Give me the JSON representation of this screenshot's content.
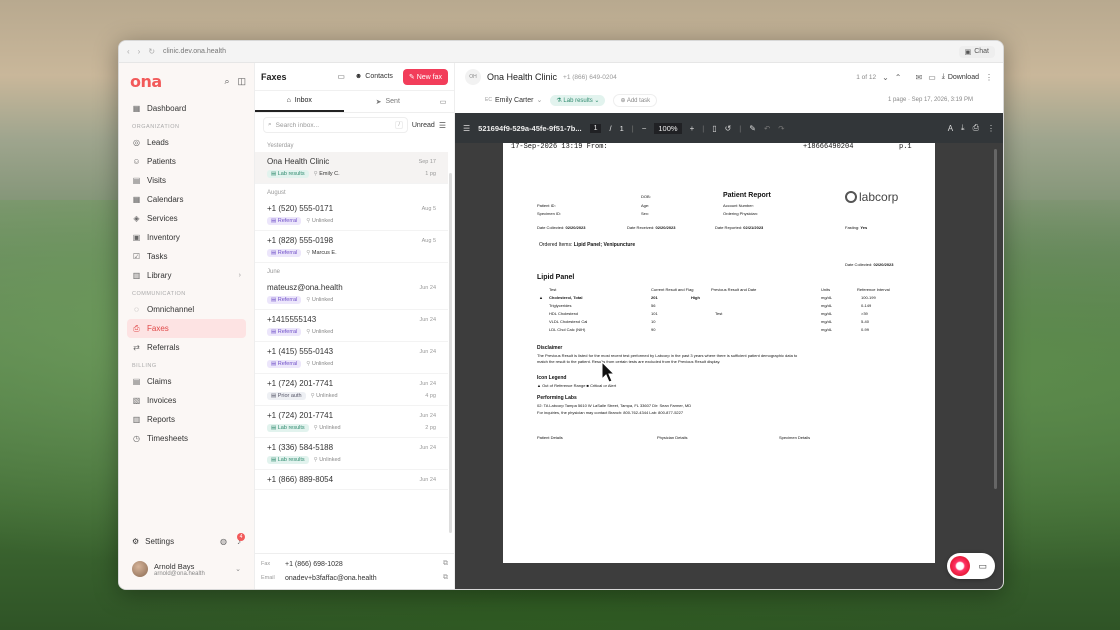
{
  "browser": {
    "url": "clinic.dev.ona.health",
    "chat_label": "Chat"
  },
  "sidebar": {
    "logo": "ona",
    "items_main": [
      {
        "label": "Dashboard",
        "icon": "dashboard-icon",
        "glyph": "▦"
      }
    ],
    "section_org": "ORGANIZATION",
    "items_org": [
      {
        "label": "Leads",
        "glyph": "◎"
      },
      {
        "label": "Patients",
        "glyph": "☺"
      },
      {
        "label": "Visits",
        "glyph": "▤"
      },
      {
        "label": "Calendars",
        "glyph": "▦"
      },
      {
        "label": "Services",
        "glyph": "◈"
      },
      {
        "label": "Inventory",
        "glyph": "▣"
      },
      {
        "label": "Tasks",
        "glyph": "☑"
      },
      {
        "label": "Library",
        "glyph": "▥"
      }
    ],
    "section_comm": "COMMUNICATION",
    "items_comm": [
      {
        "label": "Omnichannel",
        "glyph": "◌"
      },
      {
        "label": "Faxes",
        "glyph": "⎙"
      },
      {
        "label": "Referrals",
        "glyph": "⇄"
      }
    ],
    "section_billing": "BILLING",
    "items_billing": [
      {
        "label": "Claims",
        "glyph": "▤"
      },
      {
        "label": "Invoices",
        "glyph": "▧"
      },
      {
        "label": "Reports",
        "glyph": "▥"
      },
      {
        "label": "Timesheets",
        "glyph": "◷"
      }
    ],
    "settings": "Settings",
    "notif_count": "4",
    "user": {
      "name": "Arnold Bays",
      "email": "arnold@ona.health"
    }
  },
  "faxes": {
    "title": "Faxes",
    "contacts": "Contacts",
    "new_fax": "New fax",
    "tab_inbox": "Inbox",
    "tab_sent": "Sent",
    "search_placeholder": "Search inbox...",
    "search_kbd": "/",
    "unread": "Unread",
    "groups": [
      {
        "label": "Yesterday",
        "rows": [
          {
            "number": "Ona Health Clinic",
            "date": "Sep 17",
            "tag": "Lab results",
            "tagType": "lab",
            "assignee": "Emily C.",
            "named": true,
            "pages": "1 pg"
          }
        ]
      },
      {
        "label": "August",
        "rows": [
          {
            "number": "+1 (520) 555-0171",
            "date": "Aug 5",
            "tag": "Referral",
            "tagType": "ref",
            "assignee": "Unlinked",
            "named": false,
            "pages": ""
          },
          {
            "number": "+1 (828) 555-0198",
            "date": "Aug 5",
            "tag": "Referral",
            "tagType": "ref",
            "assignee": "Marcus E.",
            "named": true,
            "pages": ""
          }
        ]
      },
      {
        "label": "June",
        "rows": [
          {
            "number": "mateusz@ona.health",
            "date": "Jun 24",
            "tag": "Referral",
            "tagType": "ref",
            "assignee": "Unlinked",
            "named": false,
            "pages": ""
          },
          {
            "number": "+1415555143",
            "date": "Jun 24",
            "tag": "Referral",
            "tagType": "ref",
            "assignee": "Unlinked",
            "named": false,
            "pages": ""
          },
          {
            "number": "+1 (415) 555-0143",
            "date": "Jun 24",
            "tag": "Referral",
            "tagType": "ref",
            "assignee": "Unlinked",
            "named": false,
            "pages": ""
          },
          {
            "number": "+1 (724) 201-7741",
            "date": "Jun 24",
            "tag": "Prior auth",
            "tagType": "prior",
            "assignee": "Unlinked",
            "named": false,
            "pages": "4 pg"
          },
          {
            "number": "+1 (724) 201-7741",
            "date": "Jun 24",
            "tag": "Lab results",
            "tagType": "lab",
            "assignee": "Unlinked",
            "named": false,
            "pages": "2 pg"
          },
          {
            "number": "+1 (336) 584-5188",
            "date": "Jun 24",
            "tag": "Lab results",
            "tagType": "lab",
            "assignee": "Unlinked",
            "named": false,
            "pages": ""
          },
          {
            "number": "+1 (866) 889-8054",
            "date": "Jun 24",
            "tag": "",
            "tagType": "",
            "assignee": "",
            "named": false,
            "pages": ""
          }
        ]
      }
    ],
    "footer": {
      "fax_label": "Fax",
      "fax_value": "+1 (866) 698-1028",
      "email_label": "Email",
      "email_value": "onadev+b3faffac@ona.health"
    }
  },
  "detail": {
    "avatar": "OH",
    "name": "Ona Health Clinic",
    "phone": "+1 (866) 649-0204",
    "pager": "1 of 12",
    "download": "Download",
    "assignee": "Emily Carter",
    "tag": "Lab results",
    "add_task": "Add task",
    "meta": "1 page · Sep 17, 2026, 3:19 PM"
  },
  "viewer": {
    "filename": "521694f9-529a-45fe-9f51-7b...",
    "page": "1",
    "of": "/",
    "total": "1",
    "zoom": "100%"
  },
  "document": {
    "header_date": "17-Sep-2026  13:19    From:",
    "header_num": "+18666490204",
    "header_page": "p.1",
    "title": "Patient Report",
    "brand": "labcorp",
    "l_dob": "DOB:",
    "l_pid": "Patient ID:",
    "l_age": "Age:",
    "l_spec": "Specimen ID:",
    "l_sex": "Sex:",
    "l_acct": "Account Number:",
    "l_ordp": "Ordering Physician:",
    "date_collected_l": "Date Collected:",
    "date_collected": "02/20/2023",
    "date_received_l": "Date Received:",
    "date_received": "02/20/2023",
    "date_reported_l": "Date Reported:",
    "date_reported": "02/21/2023",
    "fasting_l": "Fasting:",
    "fasting": "Yes",
    "ordered_l": "Ordered Items:",
    "ordered": "Lipid Panel; Venipuncture",
    "panel": "Lipid Panel",
    "cols": [
      "Test",
      "Current Result and Flag",
      "Previous Result and Date",
      "Units",
      "Reference Interval"
    ],
    "rows": [
      {
        "test": "Cholesterol, Total",
        "res": "201",
        "flag": "High",
        "prev": "",
        "unit": "mg/dL",
        "ref": "100-199",
        "bold": true
      },
      {
        "test": "Triglycerides",
        "res": "56",
        "flag": "",
        "prev": "",
        "unit": "mg/dL",
        "ref": "0-149",
        "bold": false
      },
      {
        "test": "HDL Cholesterol",
        "res": "101",
        "flag": "",
        "prev": "Test",
        "unit": "mg/dL",
        "ref": ">39",
        "bold": false
      },
      {
        "test": "VLDL Cholesterol Cal",
        "res": "10",
        "flag": "",
        "prev": "",
        "unit": "mg/dL",
        "ref": "5-40",
        "bold": false
      },
      {
        "test": "LDL Chol Calc (NIH)",
        "res": "90",
        "flag": "",
        "prev": "",
        "unit": "mg/dL",
        "ref": "0-99",
        "bold": false
      }
    ],
    "disc_title": "Disclaimer",
    "disc_1": "The Previous Result is listed for the most recent test performed by Labcorp in the past 3 years where there is sufficient patient demographic data to",
    "disc_2": "match the result to the patient. Results from certain tests are excluded from the Previous Result display.",
    "icon_title": "Icon Legend",
    "icon_legend": "▲ Out of Reference Range   ■ Critical or Alert",
    "perf_title": "Performing Labs",
    "perf_1": "02: TA   Labcorp Tampa 5610 W LaSalle Street, Tampa, FL 33607 Dir: Sean Farmer, MD",
    "perf_2": "For inquiries, the physician may contact Branch: 800-762-4344 Lab: 800-877-5227",
    "foot_cols": [
      "Patient Details",
      "Physician Details",
      "Specimen Details"
    ]
  }
}
